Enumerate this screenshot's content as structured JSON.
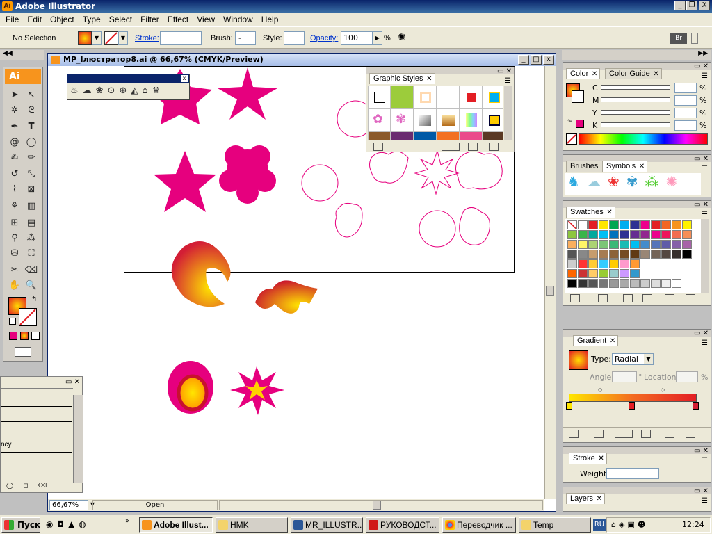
{
  "app": {
    "title": "Adobe Illustrator",
    "icon_text": "Ai",
    "min": "_",
    "restore": "❐",
    "close": "X"
  },
  "menu": [
    "File",
    "Edit",
    "Object",
    "Type",
    "Select",
    "Filter",
    "Effect",
    "View",
    "Window",
    "Help"
  ],
  "control": {
    "selection": "No Selection",
    "stroke_label": "Stroke:",
    "brush_label": "Brush:",
    "style_label": "Style:",
    "opacity_label": "Opacity:",
    "opacity_value": "100",
    "percent": "%",
    "brush_value": "-"
  },
  "document": {
    "title": "MP_Ілюстратор8.ai @ 66,67% (CMYK/Preview)",
    "zoom": "66,67%",
    "status": "Open"
  },
  "tools": {
    "logo": "Ai"
  },
  "panels": {
    "graphic_styles": {
      "tab": "Graphic Styles"
    },
    "color": {
      "tab": "Color",
      "tab2": "Color Guide",
      "channels": [
        "C",
        "M",
        "Y",
        "K"
      ],
      "unit": "%"
    },
    "brushes": {
      "tab": "Brushes",
      "tab2": "Symbols"
    },
    "swatches": {
      "tab": "Swatches"
    },
    "gradient": {
      "tab": "Gradient",
      "type_label": "Type:",
      "type_value": "Radial",
      "angle_label": "Angle:",
      "angle_unit": "°",
      "location_label": "Location:",
      "location_unit": "%"
    },
    "stroke": {
      "tab": "Stroke",
      "weight_label": "Weight:"
    },
    "layers": {
      "tab": "Layers"
    },
    "left_partial": {
      "text": "ncy"
    }
  },
  "colors": {
    "magenta": "#e6007e",
    "accent_orange": "#f7941d",
    "title_blue": "#0a246a"
  },
  "taskbar": {
    "start": "Пуск",
    "tasks": [
      "Adobe Illust...",
      "HMK",
      "MR_ILLUSTR...",
      "РУКОВОДСТ...",
      "Переводчик ...",
      "Temp"
    ],
    "lang": "RU",
    "clock": "12:24"
  }
}
